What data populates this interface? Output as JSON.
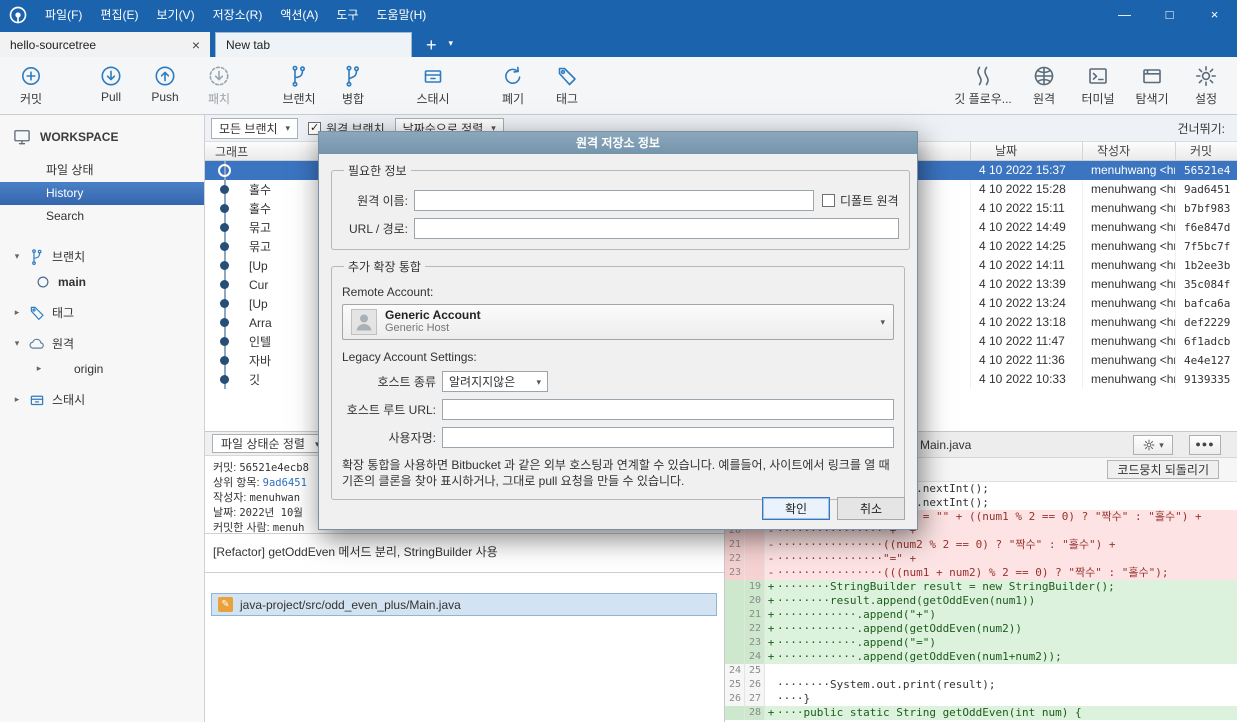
{
  "window": {
    "menu_items": [
      "파일(F)",
      "편집(E)",
      "보기(V)",
      "저장소(R)",
      "액션(A)",
      "도구",
      "도움말(H)"
    ],
    "controls": {
      "minimize": "—",
      "maximize": "□",
      "close": "×"
    }
  },
  "tabs": {
    "repo_tab": "hello-sourcetree",
    "new_tab": "New tab"
  },
  "toolbar": {
    "left": [
      {
        "label": "커밋",
        "icon": "commit-icon"
      },
      {
        "label": "Pull",
        "icon": "pull-icon"
      },
      {
        "label": "Push",
        "icon": "push-icon"
      },
      {
        "label": "패치",
        "icon": "patch-icon",
        "disabled": true
      },
      {
        "label": "브랜치",
        "icon": "branch-icon"
      },
      {
        "label": "병합",
        "icon": "merge-icon"
      },
      {
        "label": "스태시",
        "icon": "stash-icon"
      },
      {
        "label": "폐기",
        "icon": "discard-icon"
      },
      {
        "label": "태그",
        "icon": "tag-icon"
      }
    ],
    "right": [
      {
        "label": "깃 플로우...",
        "icon": "gitflow-icon"
      },
      {
        "label": "원격",
        "icon": "remote-icon"
      },
      {
        "label": "터미널",
        "icon": "terminal-icon"
      },
      {
        "label": "탐색기",
        "icon": "explorer-icon"
      },
      {
        "label": "설정",
        "icon": "settings-icon"
      }
    ]
  },
  "sidebar": {
    "workspace_label": "WORKSPACE",
    "workspace_items": [
      {
        "label": "파일 상태"
      },
      {
        "label": "History",
        "selected": true
      },
      {
        "label": "Search"
      }
    ],
    "tree": [
      {
        "label": "브랜치",
        "icon": "branch-icon",
        "chevron": "expanded",
        "level": 0
      },
      {
        "label": "main",
        "icon": "current-branch-icon",
        "chevron": "none",
        "level": 1,
        "bold": true
      },
      {
        "label": "태그",
        "icon": "tag-icon",
        "chevron": "collapsed",
        "level": 0
      },
      {
        "label": "원격",
        "icon": "cloud-icon",
        "chevron": "expanded",
        "level": 0
      },
      {
        "label": "origin",
        "icon": "",
        "chevron": "collapsed",
        "level": 1
      },
      {
        "label": "스태시",
        "icon": "stash-icon",
        "chevron": "collapsed",
        "level": 0
      }
    ]
  },
  "history": {
    "branch_filter": "모든 브랜치",
    "remote_checkbox_label": "원격 브랜치",
    "remote_checkbox_checked": true,
    "sort_filter": "날짜순으로 정렬",
    "skip_label": "건너뛰기:",
    "columns": {
      "graph": "그래프",
      "date": "날짜",
      "author": "작성자",
      "commit": "커밋"
    },
    "rows": [
      {
        "message": "",
        "date": "4 10 2022 15:37",
        "author": "menuhwang <hm",
        "commit": "56521e4",
        "selected": true
      },
      {
        "message": "홀수",
        "date": "4 10 2022 15:28",
        "author": "menuhwang <hm",
        "commit": "9ad6451"
      },
      {
        "message": "홀수",
        "date": "4 10 2022 15:11",
        "author": "menuhwang <hm",
        "commit": "b7bf983"
      },
      {
        "message": "묶고",
        "date": "4 10 2022 14:49",
        "author": "menuhwang <hm",
        "commit": "f6e847d"
      },
      {
        "message": "묶고",
        "date": "4 10 2022 14:25",
        "author": "menuhwang <hm",
        "commit": "7f5bc7f"
      },
      {
        "message": "[Up",
        "date": "4 10 2022 14:11",
        "author": "menuhwang <hm",
        "commit": "1b2ee3b"
      },
      {
        "message": "Cur",
        "date": "4 10 2022 13:39",
        "author": "menuhwang <hm",
        "commit": "35c084f"
      },
      {
        "message": "[Up",
        "date": "4 10 2022 13:24",
        "author": "menuhwang <hm",
        "commit": "bafca6a"
      },
      {
        "message": "Arra",
        "date": "4 10 2022 13:18",
        "author": "menuhwang <hm",
        "commit": "def2229"
      },
      {
        "message": "인텔",
        "date": "4 10 2022 11:47",
        "author": "menuhwang <hm",
        "commit": "6f1adcb"
      },
      {
        "message": "자바",
        "date": "4 10 2022 11:36",
        "author": "menuhwang <hm",
        "commit": "4e4e127"
      },
      {
        "message": "깃",
        "date": "4 10 2022 10:33",
        "author": "menuhwang <hm",
        "commit": "9139335"
      }
    ]
  },
  "dialog": {
    "title": "원격 저장소 정보",
    "required_group_label": "필요한 정보",
    "remote_name_label": "원격 이름:",
    "remote_name_value": "",
    "default_remote_label": "디폴트 원격",
    "default_remote_checked": false,
    "url_label": "URL / 경로:",
    "url_value": "",
    "integration_group_label": "추가 확장 통합",
    "remote_account_label": "Remote Account:",
    "account_name": "Generic Account",
    "account_host": "Generic Host",
    "legacy_settings_label": "Legacy Account Settings:",
    "host_type_label": "호스트 종류",
    "host_type_value": "알려지지않은",
    "host_root_label": "호스트 루트 URL:",
    "host_root_value": "",
    "username_label": "사용자명:",
    "username_value": "",
    "help_text": "확장 통합을 사용하면 Bitbucket 과 같은 외부 호스팅과 연계할 수 있습니다. 예를들어, 사이트에서 링크를 열 때 기존의 클론을 찾아 표시하거나, 그대로 pull 요청을 만들 수 있습니다.",
    "ok_label": "확인",
    "cancel_label": "취소"
  },
  "commit_detail": {
    "sort_label": "파일 상태순 정렬",
    "fields": [
      {
        "label": "커밋:",
        "value": "56521e4ecb8"
      },
      {
        "label": "상위 항목:",
        "value": "9ad6451",
        "link": true
      },
      {
        "label": "작성자:",
        "value": "menuhwan"
      },
      {
        "label": "날짜:",
        "value": "2022년 10월"
      },
      {
        "label": "커밋한 사람:",
        "value": "menuh"
      }
    ],
    "message": "[Refactor] getOddEven 메서드 분리, StringBuilder 사용",
    "file": "java-project/src/odd_even_plus/Main.java"
  },
  "diff": {
    "file_label": "Main.java",
    "menu_dots": "●●●",
    "hunk_button": "코드뭉치 되돌리기",
    "lines": [
      {
        "old": "17",
        "new": "17",
        "type": "ctx",
        "text": "········int num1 = sc.nextInt();"
      },
      {
        "old": "18",
        "new": "18",
        "type": "ctx",
        "text": "········int num2 = sc.nextInt();"
      },
      {
        "old": "19",
        "new": "",
        "type": "del",
        "text": "········String result = \"\" + ((num1 % 2 == 0) ? \"짝수\" : \"홀수\") +"
      },
      {
        "old": "20",
        "new": "",
        "type": "del",
        "text": "················\"+\" +"
      },
      {
        "old": "21",
        "new": "",
        "type": "del",
        "text": "················((num2 % 2 == 0) ? \"짝수\" : \"홀수\") +"
      },
      {
        "old": "22",
        "new": "",
        "type": "del",
        "text": "················\"=\" +"
      },
      {
        "old": "23",
        "new": "",
        "type": "del",
        "text": "················(((num1 + num2) % 2 == 0) ? \"짝수\" : \"홀수\");"
      },
      {
        "old": "",
        "new": "19",
        "type": "add",
        "text": "········StringBuilder result = new StringBuilder();"
      },
      {
        "old": "",
        "new": "20",
        "type": "add",
        "text": "········result.append(getOddEven(num1))"
      },
      {
        "old": "",
        "new": "21",
        "type": "add",
        "text": "············.append(\"+\")"
      },
      {
        "old": "",
        "new": "22",
        "type": "add",
        "text": "············.append(getOddEven(num2))"
      },
      {
        "old": "",
        "new": "23",
        "type": "add",
        "text": "············.append(\"=\")"
      },
      {
        "old": "",
        "new": "24",
        "type": "add",
        "text": "············.append(getOddEven(num1+num2));"
      },
      {
        "old": "24",
        "new": "25",
        "type": "ctx",
        "text": ""
      },
      {
        "old": "25",
        "new": "26",
        "type": "ctx",
        "text": "········System.out.print(result);"
      },
      {
        "old": "26",
        "new": "27",
        "type": "ctx",
        "text": "····}"
      },
      {
        "old": "",
        "new": "28",
        "type": "add",
        "text": "····public static String getOddEven(int num) {"
      }
    ]
  }
}
